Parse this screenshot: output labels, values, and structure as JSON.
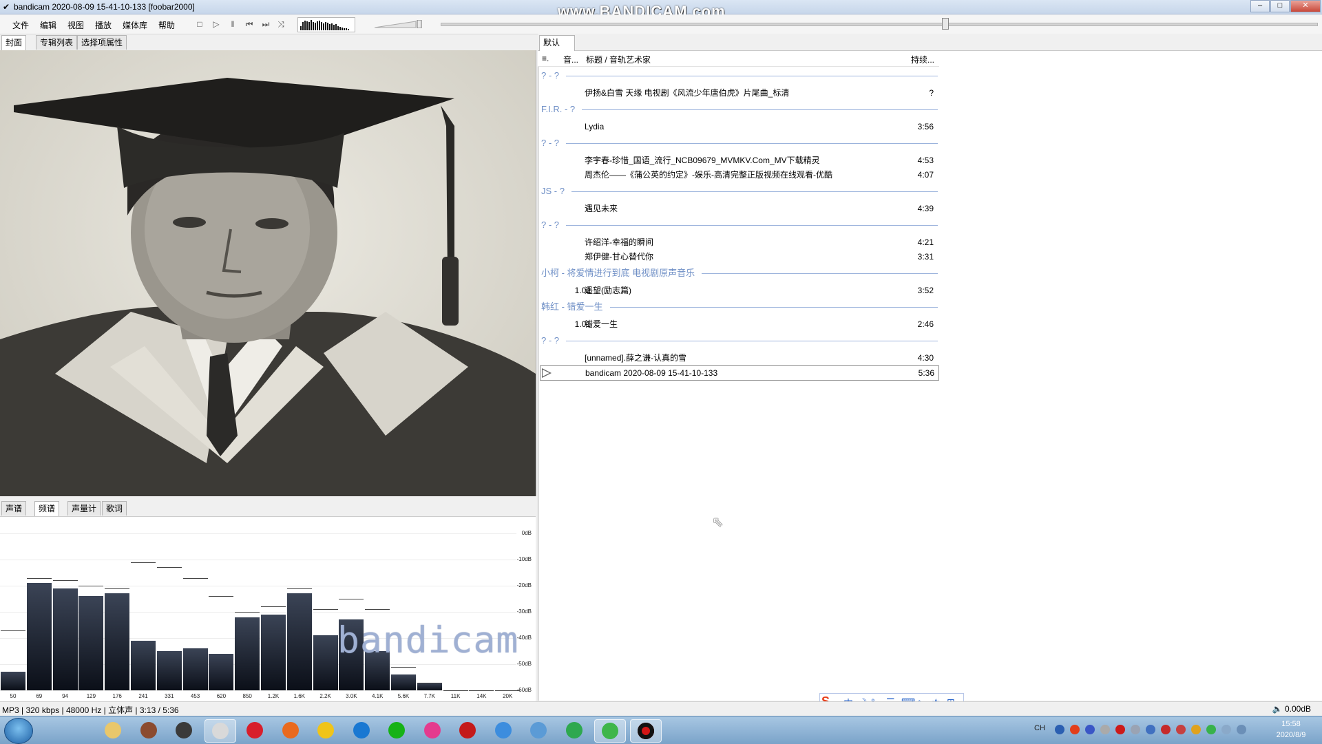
{
  "window": {
    "title": "bandicam 2020-08-09 15-41-10-133  [foobar2000]",
    "watermark": "www.BANDICAM.com",
    "buttons": {
      "minimize": "–",
      "maximize": "□",
      "close": "✕"
    }
  },
  "menu": {
    "items": [
      "文件",
      "编辑",
      "视图",
      "播放",
      "媒体库",
      "帮助"
    ]
  },
  "toolbar": {
    "stop": "□",
    "play": "▷",
    "pause": "‖",
    "prev": "⏮",
    "next": "⏭",
    "random": "⤨"
  },
  "left_tabs": [
    "封面",
    "专辑列表",
    "选择项属性"
  ],
  "viz_tabs": [
    "声谱",
    "频谱",
    "声量计",
    "歌词"
  ],
  "spectrum": {
    "db_labels": [
      "0dB",
      "-10dB",
      "-20dB",
      "-30dB",
      "-40dB",
      "-50dB",
      "-60dB"
    ],
    "freq_labels": [
      "50",
      "69",
      "94",
      "129",
      "176",
      "241",
      "331",
      "453",
      "620",
      "850",
      "1.2K",
      "1.6K",
      "2.2K",
      "3.0K",
      "4.1K",
      "5.6K",
      "7.7K",
      "11K",
      "14K",
      "20K"
    ],
    "bar_levels_db": [
      -53,
      -19,
      -21,
      -24,
      -23,
      -41,
      -45,
      -44,
      -46,
      -32,
      -31,
      -23,
      -39,
      -33,
      -45,
      -54,
      -57,
      -60,
      -60,
      -60
    ],
    "peak_levels_db": [
      -37,
      -17,
      -18,
      -20,
      -21,
      -11,
      -13,
      -17,
      -24,
      -30,
      -28,
      -21,
      -29,
      -25,
      -29,
      -51,
      -57,
      -60,
      -60,
      -60
    ]
  },
  "playlist": {
    "tab": "默认",
    "columns": {
      "num": "音...",
      "index": "≡.",
      "title": "标题 / 音轨艺术家",
      "duration": "持续..."
    },
    "groups": [
      {
        "header": "? - ?",
        "tracks": [
          {
            "num": "",
            "title": "伊扬&白雪 天缘 电视剧《风流少年唐伯虎》片尾曲_标清",
            "duration": "?"
          }
        ]
      },
      {
        "header": "F.I.R. - ?",
        "tracks": [
          {
            "num": "",
            "title": "Lydia",
            "duration": "3:56"
          }
        ]
      },
      {
        "header": "? - ?",
        "tracks": [
          {
            "num": "",
            "title": "李宇春-珍惜_国语_流行_NCB09679_MVMKV.Com_MV下载精灵",
            "duration": "4:53"
          },
          {
            "num": "",
            "title": "周杰伦——《蒲公英的约定》-娱乐-高清完整正版视频在线观看-优酷",
            "duration": "4:07"
          }
        ]
      },
      {
        "header": "JS - ?",
        "tracks": [
          {
            "num": "",
            "title": "遇见未来",
            "duration": "4:39"
          }
        ]
      },
      {
        "header": "? - ?",
        "tracks": [
          {
            "num": "",
            "title": "许绍洋-幸福的瞬间",
            "duration": "4:21"
          },
          {
            "num": "",
            "title": "郑伊健-甘心替代你",
            "duration": "3:31"
          }
        ]
      },
      {
        "header": "小柯 - 将爱情进行到底 电视剧原声音乐",
        "tracks": [
          {
            "num": "1.02",
            "title": "遥望(励志篇)",
            "duration": "3:52"
          }
        ]
      },
      {
        "header": "韩红 - 错爱一生",
        "tracks": [
          {
            "num": "1.01",
            "title": "错爱一生",
            "duration": "2:46"
          }
        ]
      },
      {
        "header": "? - ?",
        "tracks": [
          {
            "num": "",
            "title": "[unnamed].薛之谦-认真的雪",
            "duration": "4:30"
          },
          {
            "num": "",
            "title": "bandicam 2020-08-09 15-41-10-133",
            "duration": "5:36",
            "playing": true
          }
        ]
      }
    ]
  },
  "overlay_text": "bandicam 2020-08-09 15-41-10-133",
  "ime": {
    "logo": "S",
    "items": [
      "中",
      "☽",
      "°,",
      "☰",
      "⌨",
      "⌂",
      "★",
      "⊞"
    ]
  },
  "status": {
    "left": "MP3 | 320 kbps | 48000 Hz | 立体声 | 3:13 / 5:36",
    "right": "🔈 0.00dB"
  },
  "taskbar": {
    "lang": "CH",
    "time": "15:58",
    "date": "2020/8/9",
    "apps": [
      "explorer",
      "calendar",
      "headphones",
      "alien",
      "netease-music",
      "chrome-like",
      "player",
      "1-app",
      "iqiyi",
      "youku",
      "flash",
      "chrome",
      "bird",
      "video-player",
      "green-app",
      "bandicam"
    ],
    "colors": {
      "accent": "#1d5fa4",
      "record": "#d31515"
    }
  }
}
